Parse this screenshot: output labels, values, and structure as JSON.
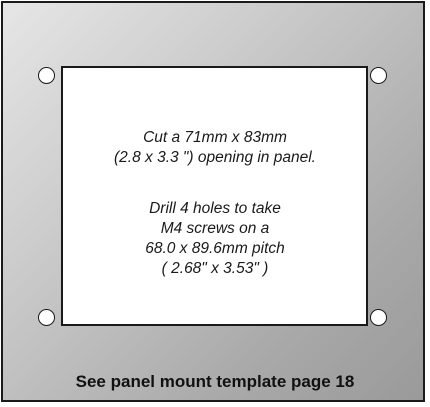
{
  "cutout": {
    "cut_text": [
      "Cut a 71mm x 83mm",
      "(2.8 x 3.3 \") opening in panel."
    ],
    "drill_text": [
      "Drill 4 holes to take",
      "M4 screws on a",
      "68.0 x 89.6mm pitch",
      "( 2.68\" x 3.53\" )"
    ]
  },
  "footer": {
    "label": "See panel mount template page 18"
  }
}
